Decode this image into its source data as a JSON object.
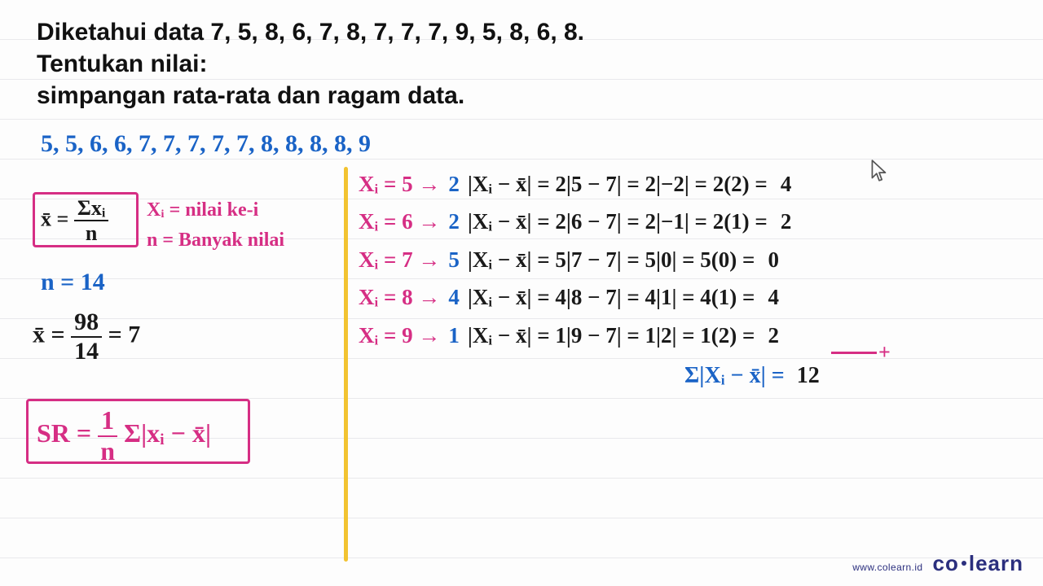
{
  "question": {
    "line1": "Diketahui data 7, 5, 8, 6, 7, 8, 7, 7, 7, 9, 5, 8, 6, 8.",
    "line2": "Tentukan nilai:",
    "line3": "simpangan rata-rata dan ragam data."
  },
  "sorted_data": "5, 5, 6, 6, 7, 7, 7, 7, 7, 8, 8, 8, 8, 9",
  "mean_formula": {
    "lhs": "x̄ =",
    "num": "Σxᵢ",
    "den": "n"
  },
  "notes": {
    "xi": "Xᵢ = nilai ke-i",
    "n": "n = Banyak nilai"
  },
  "n_line": "n = 14",
  "xbar_calc": {
    "lhs": "x̄ =",
    "num": "98",
    "den": "14",
    "rhs": "= 7"
  },
  "sr_formula": {
    "lhs": "SR =",
    "one": "1",
    "n": "n",
    "sum": "Σ|xᵢ − x̄|"
  },
  "rows": [
    {
      "xi": "Xᵢ = 5 →",
      "f": "2",
      "expr": "|Xᵢ − x̄| = 2|5 − 7| = 2|−2| = 2(2) =",
      "res": "4"
    },
    {
      "xi": "Xᵢ = 6 →",
      "f": "2",
      "expr": "|Xᵢ − x̄| = 2|6 − 7| = 2|−1| = 2(1) =",
      "res": "2"
    },
    {
      "xi": "Xᵢ = 7 →",
      "f": "5",
      "expr": "|Xᵢ − x̄| = 5|7 − 7| = 5|0| = 5(0) =",
      "res": "0"
    },
    {
      "xi": "Xᵢ = 8 →",
      "f": "4",
      "expr": "|Xᵢ − x̄| = 4|8 − 7| = 4|1| = 4(1) =",
      "res": "4"
    },
    {
      "xi": "Xᵢ = 9 →",
      "f": "1",
      "expr": "|Xᵢ − x̄| = 1|9 − 7| = 1|2| = 1(2) =",
      "res": "2"
    }
  ],
  "sum_label": "Σ|Xᵢ − x̄| =",
  "sum_value": "12",
  "plus": "+",
  "brand": {
    "url": "www.colearn.id",
    "logo_a": "co",
    "logo_b": "learn"
  }
}
